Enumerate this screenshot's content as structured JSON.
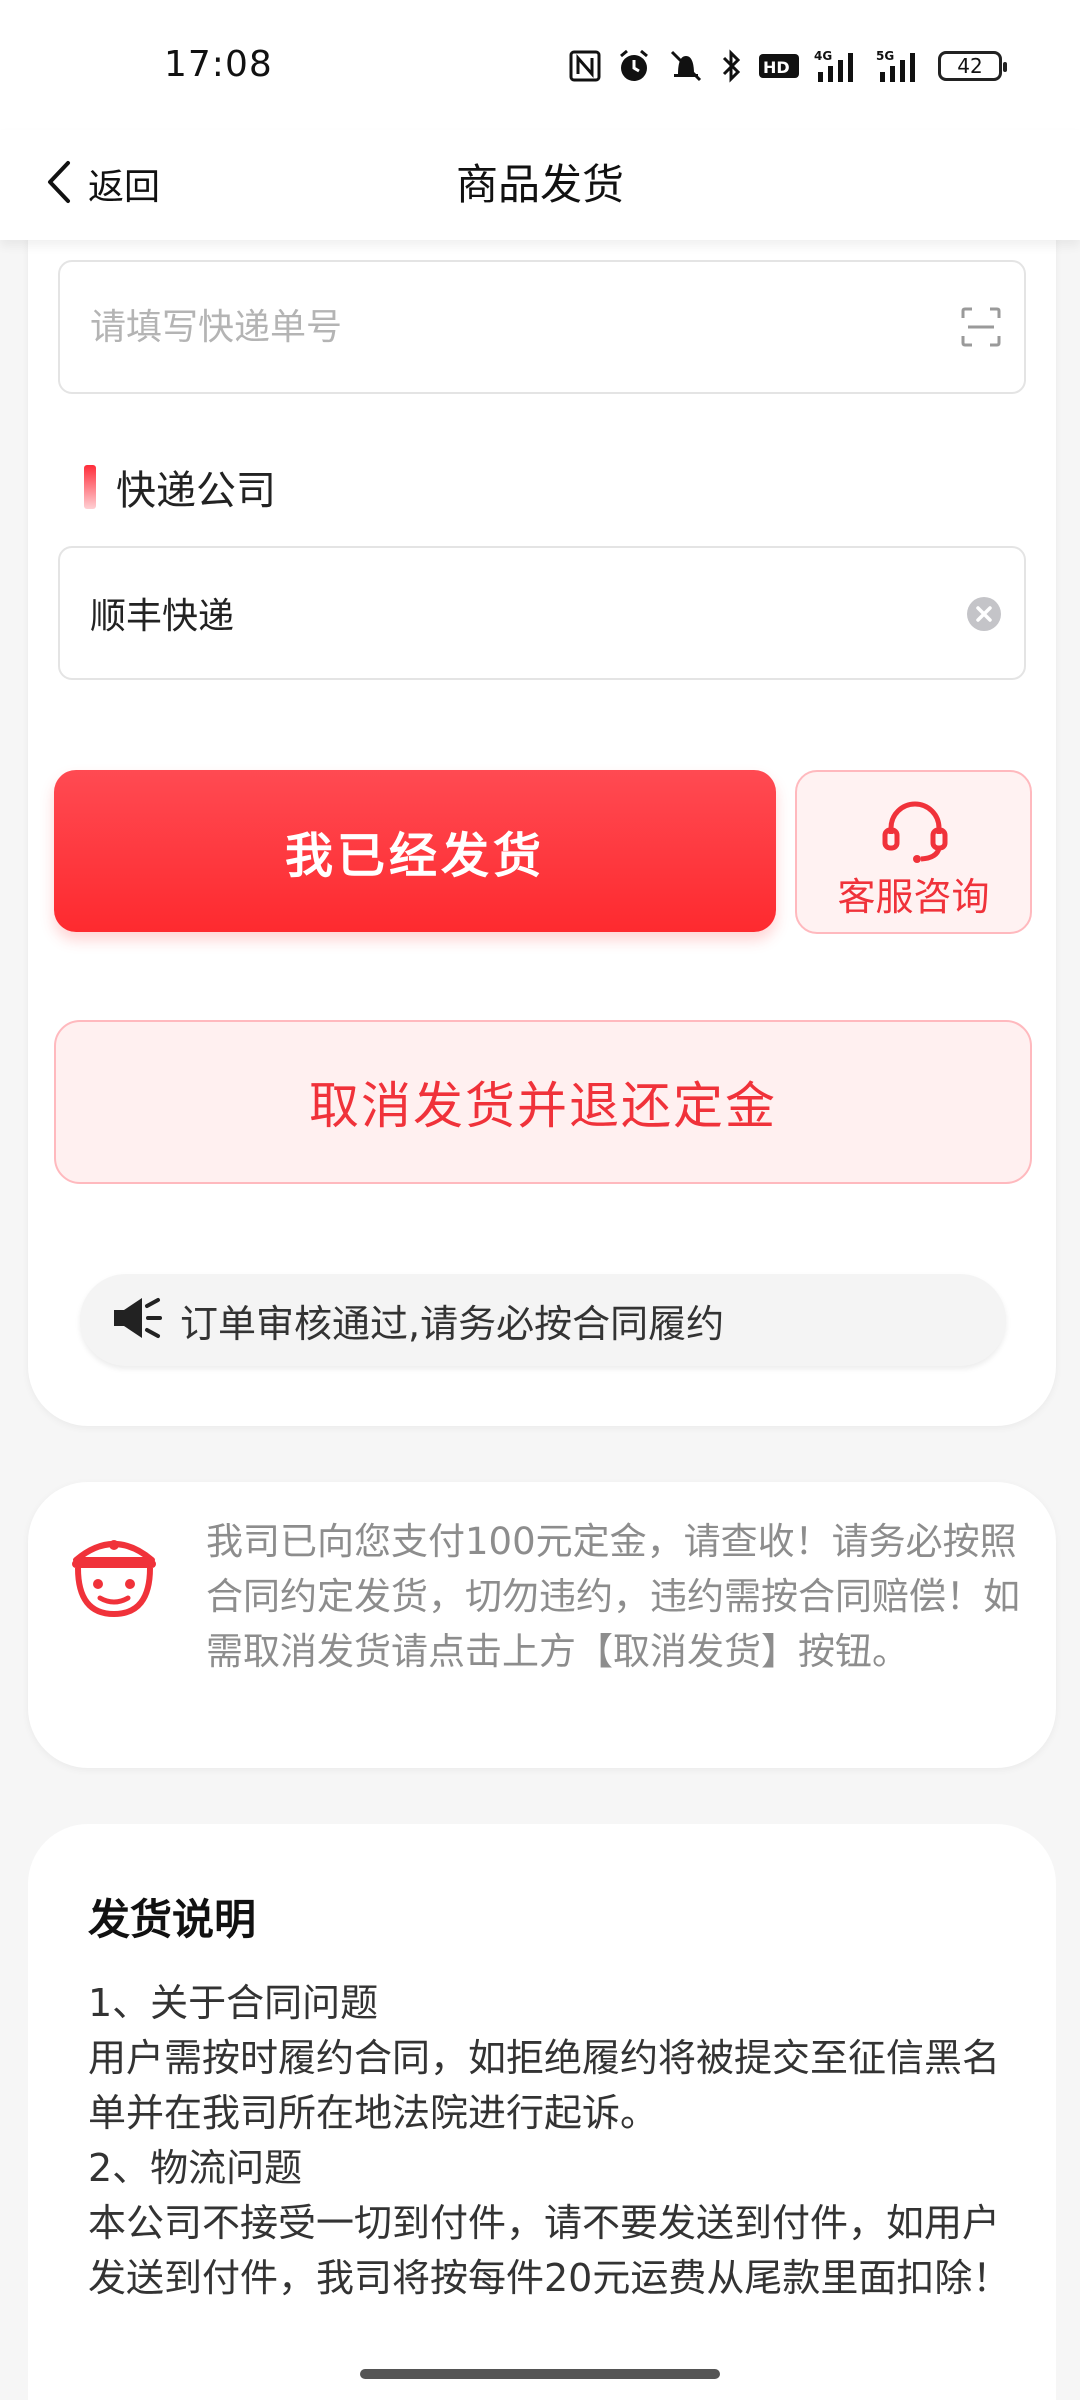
{
  "status_bar": {
    "time": "17:08",
    "icons": [
      "nfc-icon",
      "alarm-icon",
      "mute-icon",
      "bluetooth-icon",
      "hd-icon",
      "signal-4g-icon",
      "signal-5g-icon"
    ],
    "signal_labels": [
      "HD",
      "4G",
      "5G"
    ],
    "battery": "42"
  },
  "nav": {
    "back_label": "返回",
    "title": "商品发货"
  },
  "form": {
    "tracking_placeholder": "请填写快递单号",
    "tracking_value": "",
    "company_label": "快递公司",
    "company_value": "顺丰快递"
  },
  "actions": {
    "shipped_label": "我已经发货",
    "service_label": "客服咨询",
    "cancel_label": "取消发货并退还定金"
  },
  "notice": {
    "text": "订单审核通过,请务必按合同履约"
  },
  "info": {
    "text": "我司已向您支付100元定金，请查收！请务必按照合同约定发货，切勿违约，违约需按合同赔偿！如需取消发货请点击上方【取消发货】按钮。"
  },
  "explain": {
    "title": "发货说明",
    "lines": [
      "1、关于合同问题",
      "用户需按时履约合同，如拒绝履约将被提交至征信黑名单并在我司所在地法院进行起诉。",
      "2、物流问题",
      "本公司不接受一切到付件，请不要发送到付件，如用户发送到付件，我司将按每件20元运费从尾款里面扣除！"
    ]
  },
  "colors": {
    "accent": "#fe2a2f",
    "accent_light": "#fff0f0",
    "accent_border": "#ffb9be",
    "muted_text": "#8d8d8d"
  }
}
